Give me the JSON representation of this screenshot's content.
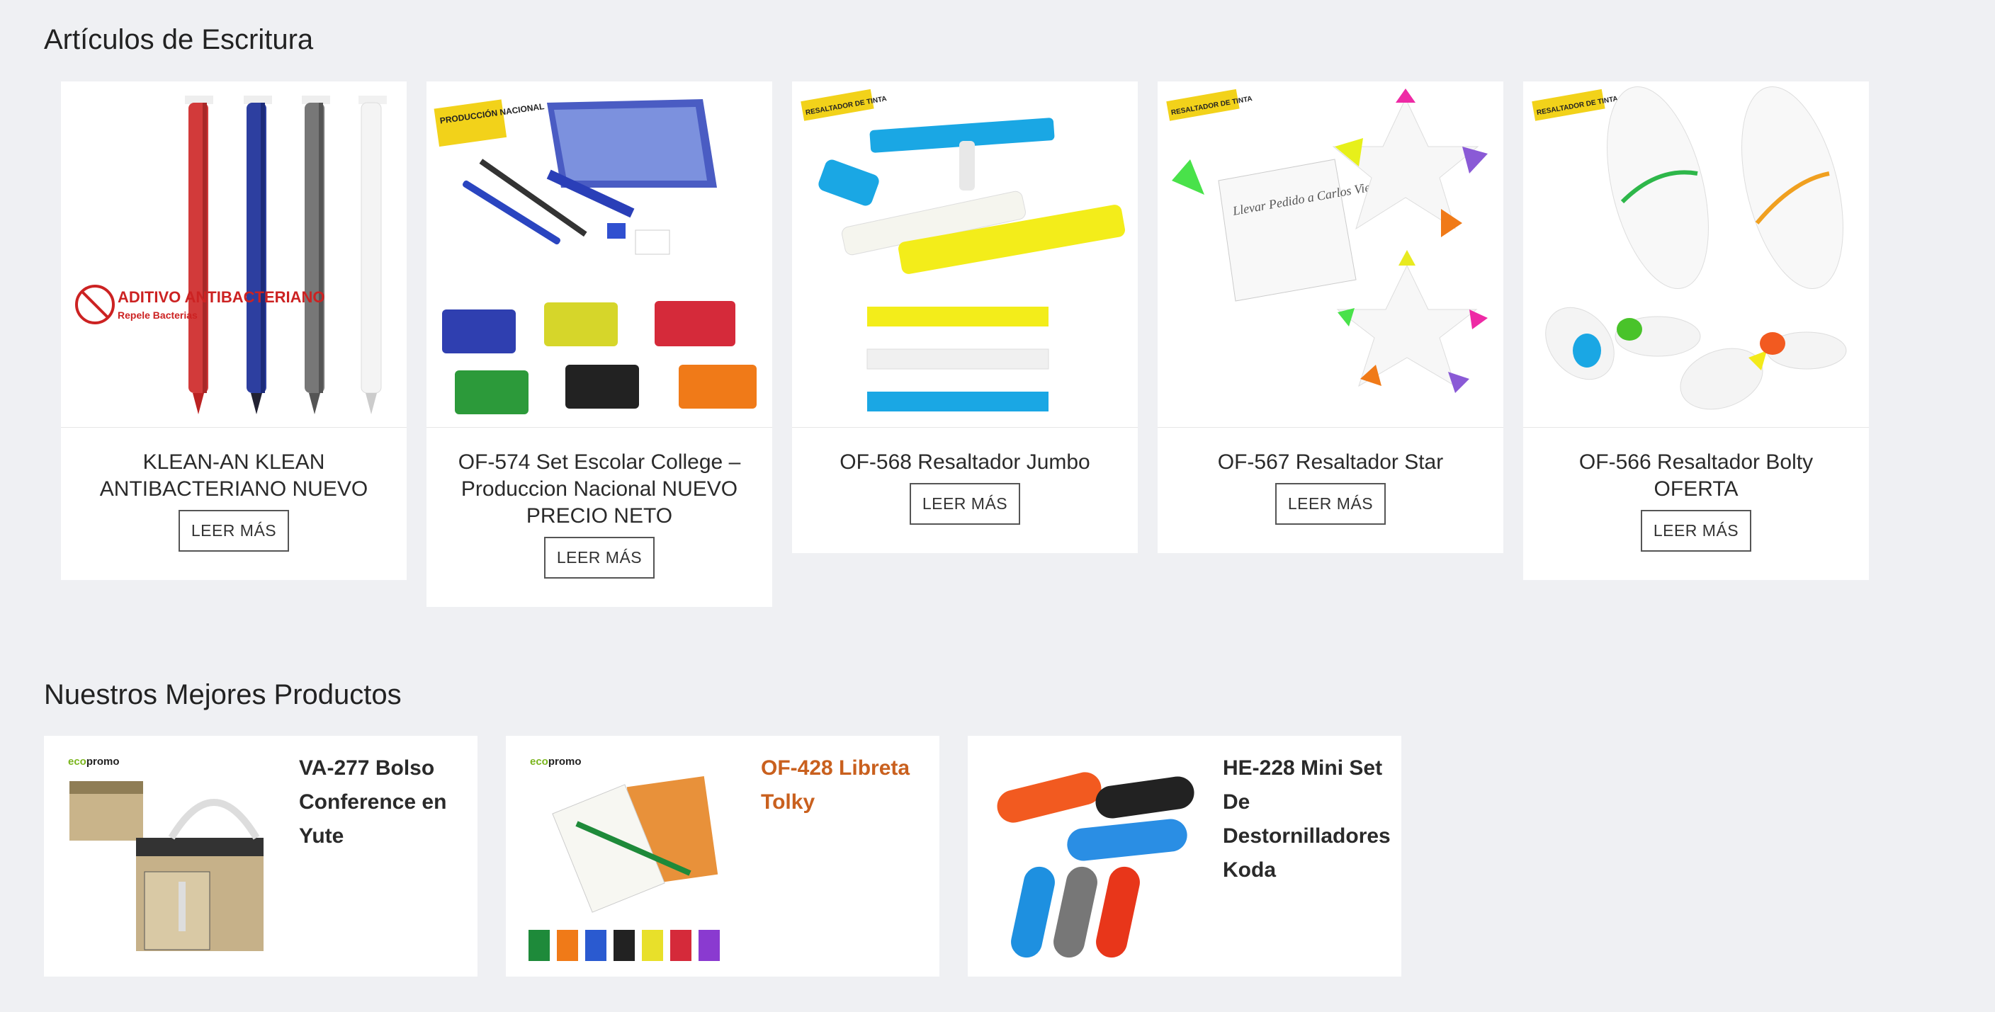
{
  "sections": {
    "writing_title": "Artículos de Escritura",
    "best_title": "Nuestros Mejores Productos"
  },
  "products": [
    {
      "title": "KLEAN-AN KLEAN ANTIBACTERIANO NUEVO",
      "button": "LEER MÁS",
      "image": "pens-antibacterial",
      "badge": "ADITIVO ANTIBACTERIANO",
      "badge_sub": "Repele Bacterias"
    },
    {
      "title": "OF-574 Set Escolar College – Produccion Nacional NUEVO PRECIO NETO",
      "button": "LEER MÁS",
      "image": "school-set",
      "badge": "PRODUCCIÓN NACIONAL"
    },
    {
      "title": "OF-568 Resaltador Jumbo",
      "button": "LEER MÁS",
      "image": "highlighter-jumbo",
      "badge": "RESALTADOR DE TINTA"
    },
    {
      "title": "OF-567 Resaltador Star",
      "button": "LEER MÁS",
      "image": "highlighter-star",
      "badge": "RESALTADOR DE TINTA",
      "note_text": "Llevar Pedido a Carlos Viernes"
    },
    {
      "title": "OF-566 Resaltador Bolty OFERTA",
      "button": "LEER MÁS",
      "image": "highlighter-bolty",
      "badge": "RESALTADOR DE TINTA"
    }
  ],
  "best_products": [
    {
      "title": "VA-277 Bolso Conference en Yute",
      "image": "jute-bag",
      "brand_a": "eco",
      "brand_b": "promo",
      "highlight": false
    },
    {
      "title": "OF-428 Libreta Tolky",
      "image": "notebook",
      "brand_a": "eco",
      "brand_b": "promo",
      "highlight": true,
      "accent_color": "#c9601e"
    },
    {
      "title": "HE-228 Mini Set De Destornilladores Koda",
      "image": "screwdriver-set",
      "highlight": false
    }
  ],
  "colors": {
    "background": "#eff0f3",
    "card": "#ffffff",
    "accent": "#c9601e",
    "text": "#2a2a2a"
  }
}
